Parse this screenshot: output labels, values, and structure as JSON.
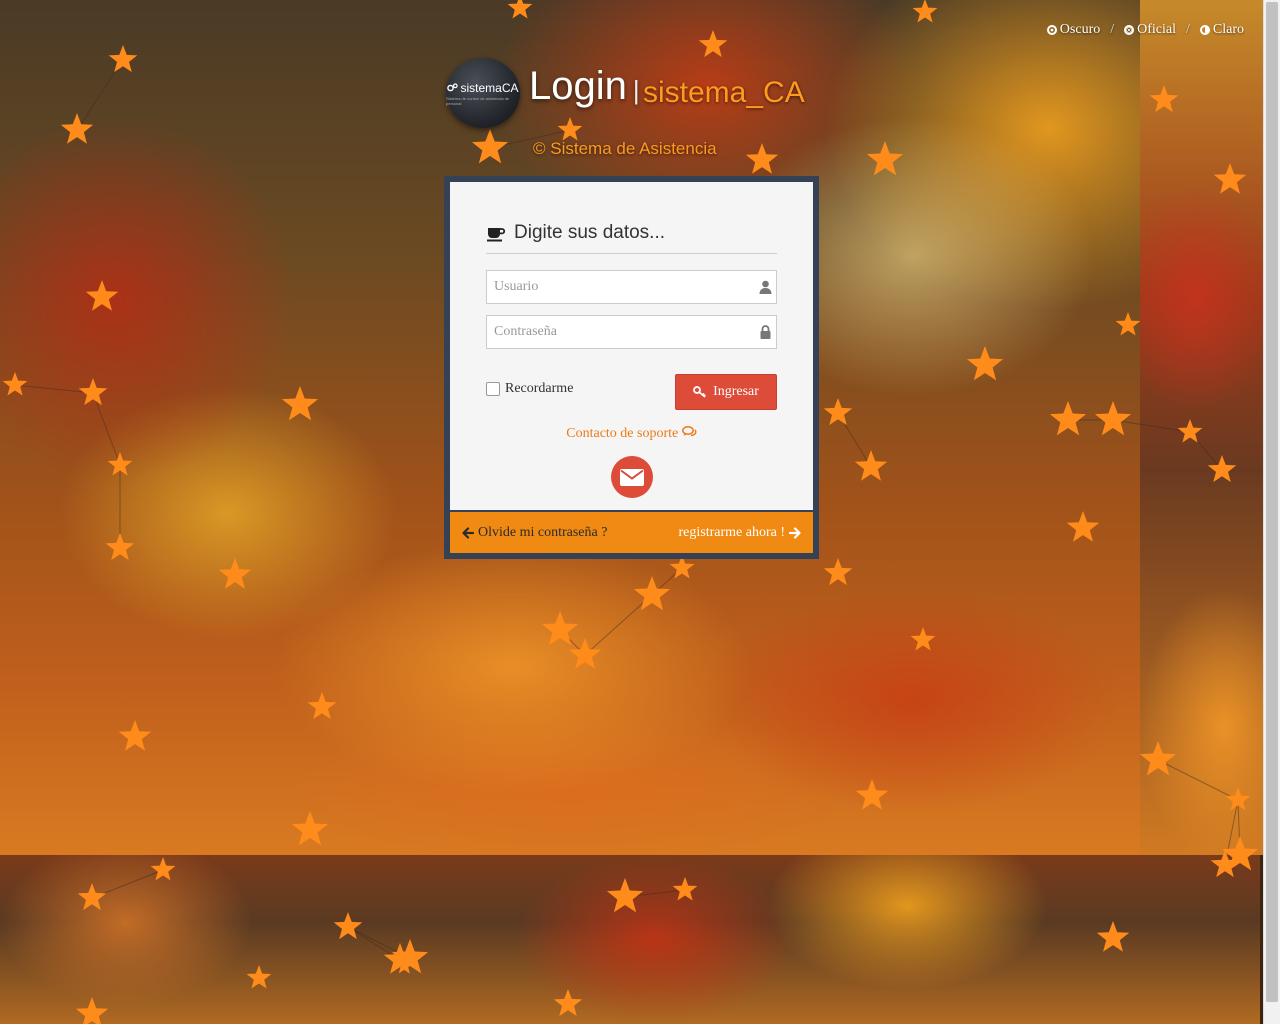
{
  "theme_switch": {
    "options": [
      {
        "label": "Oscuro",
        "icon": "dot-circle-icon"
      },
      {
        "label": "Oficial",
        "icon": "bullseye-icon"
      },
      {
        "label": "Claro",
        "icon": "adjust-icon"
      }
    ],
    "separator": "/"
  },
  "header": {
    "logo_text": "sistemaCA",
    "logo_subtext": "Sistema de control de asistencia de personal",
    "title": "Login",
    "title_separator": "|",
    "subtitle": "sistema_CA",
    "copyright": "© Sistema de Asistencia"
  },
  "login_form": {
    "heading": "Digite sus datos...",
    "heading_icon": "coffee-icon",
    "username_placeholder": "Usuario",
    "username_value": "",
    "password_placeholder": "Contraseña",
    "password_value": "",
    "remember_label": "Recordarme",
    "remember_checked": false,
    "submit_label": "Ingresar",
    "support_label": "Contacto de soporte",
    "forgot_label": "Olvide mi contraseña ?",
    "register_label": "registrarme ahora !"
  },
  "colors": {
    "accent_orange": "#f18a12",
    "button_red": "#dd4b39",
    "card_border": "#354155",
    "link_orange": "#ec7a17"
  }
}
